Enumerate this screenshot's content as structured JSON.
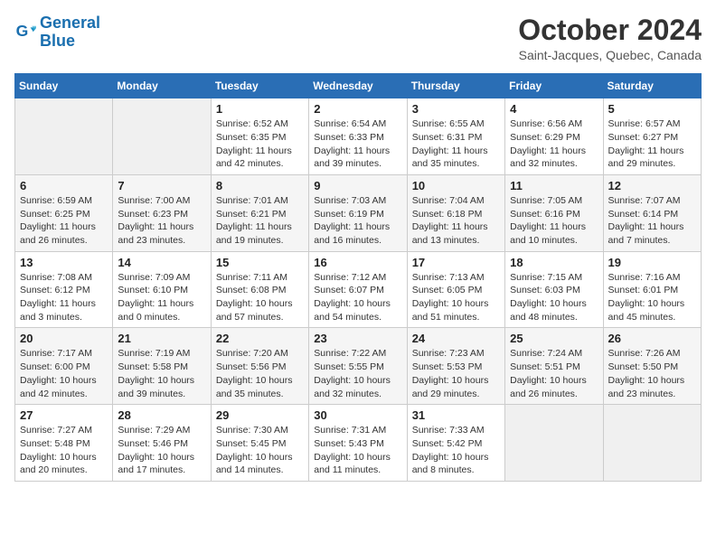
{
  "header": {
    "logo_line1": "General",
    "logo_line2": "Blue",
    "month": "October 2024",
    "location": "Saint-Jacques, Quebec, Canada"
  },
  "weekdays": [
    "Sunday",
    "Monday",
    "Tuesday",
    "Wednesday",
    "Thursday",
    "Friday",
    "Saturday"
  ],
  "weeks": [
    [
      {
        "day": "",
        "info": ""
      },
      {
        "day": "",
        "info": ""
      },
      {
        "day": "1",
        "info": "Sunrise: 6:52 AM\nSunset: 6:35 PM\nDaylight: 11 hours and 42 minutes."
      },
      {
        "day": "2",
        "info": "Sunrise: 6:54 AM\nSunset: 6:33 PM\nDaylight: 11 hours and 39 minutes."
      },
      {
        "day": "3",
        "info": "Sunrise: 6:55 AM\nSunset: 6:31 PM\nDaylight: 11 hours and 35 minutes."
      },
      {
        "day": "4",
        "info": "Sunrise: 6:56 AM\nSunset: 6:29 PM\nDaylight: 11 hours and 32 minutes."
      },
      {
        "day": "5",
        "info": "Sunrise: 6:57 AM\nSunset: 6:27 PM\nDaylight: 11 hours and 29 minutes."
      }
    ],
    [
      {
        "day": "6",
        "info": "Sunrise: 6:59 AM\nSunset: 6:25 PM\nDaylight: 11 hours and 26 minutes."
      },
      {
        "day": "7",
        "info": "Sunrise: 7:00 AM\nSunset: 6:23 PM\nDaylight: 11 hours and 23 minutes."
      },
      {
        "day": "8",
        "info": "Sunrise: 7:01 AM\nSunset: 6:21 PM\nDaylight: 11 hours and 19 minutes."
      },
      {
        "day": "9",
        "info": "Sunrise: 7:03 AM\nSunset: 6:19 PM\nDaylight: 11 hours and 16 minutes."
      },
      {
        "day": "10",
        "info": "Sunrise: 7:04 AM\nSunset: 6:18 PM\nDaylight: 11 hours and 13 minutes."
      },
      {
        "day": "11",
        "info": "Sunrise: 7:05 AM\nSunset: 6:16 PM\nDaylight: 11 hours and 10 minutes."
      },
      {
        "day": "12",
        "info": "Sunrise: 7:07 AM\nSunset: 6:14 PM\nDaylight: 11 hours and 7 minutes."
      }
    ],
    [
      {
        "day": "13",
        "info": "Sunrise: 7:08 AM\nSunset: 6:12 PM\nDaylight: 11 hours and 3 minutes."
      },
      {
        "day": "14",
        "info": "Sunrise: 7:09 AM\nSunset: 6:10 PM\nDaylight: 11 hours and 0 minutes."
      },
      {
        "day": "15",
        "info": "Sunrise: 7:11 AM\nSunset: 6:08 PM\nDaylight: 10 hours and 57 minutes."
      },
      {
        "day": "16",
        "info": "Sunrise: 7:12 AM\nSunset: 6:07 PM\nDaylight: 10 hours and 54 minutes."
      },
      {
        "day": "17",
        "info": "Sunrise: 7:13 AM\nSunset: 6:05 PM\nDaylight: 10 hours and 51 minutes."
      },
      {
        "day": "18",
        "info": "Sunrise: 7:15 AM\nSunset: 6:03 PM\nDaylight: 10 hours and 48 minutes."
      },
      {
        "day": "19",
        "info": "Sunrise: 7:16 AM\nSunset: 6:01 PM\nDaylight: 10 hours and 45 minutes."
      }
    ],
    [
      {
        "day": "20",
        "info": "Sunrise: 7:17 AM\nSunset: 6:00 PM\nDaylight: 10 hours and 42 minutes."
      },
      {
        "day": "21",
        "info": "Sunrise: 7:19 AM\nSunset: 5:58 PM\nDaylight: 10 hours and 39 minutes."
      },
      {
        "day": "22",
        "info": "Sunrise: 7:20 AM\nSunset: 5:56 PM\nDaylight: 10 hours and 35 minutes."
      },
      {
        "day": "23",
        "info": "Sunrise: 7:22 AM\nSunset: 5:55 PM\nDaylight: 10 hours and 32 minutes."
      },
      {
        "day": "24",
        "info": "Sunrise: 7:23 AM\nSunset: 5:53 PM\nDaylight: 10 hours and 29 minutes."
      },
      {
        "day": "25",
        "info": "Sunrise: 7:24 AM\nSunset: 5:51 PM\nDaylight: 10 hours and 26 minutes."
      },
      {
        "day": "26",
        "info": "Sunrise: 7:26 AM\nSunset: 5:50 PM\nDaylight: 10 hours and 23 minutes."
      }
    ],
    [
      {
        "day": "27",
        "info": "Sunrise: 7:27 AM\nSunset: 5:48 PM\nDaylight: 10 hours and 20 minutes."
      },
      {
        "day": "28",
        "info": "Sunrise: 7:29 AM\nSunset: 5:46 PM\nDaylight: 10 hours and 17 minutes."
      },
      {
        "day": "29",
        "info": "Sunrise: 7:30 AM\nSunset: 5:45 PM\nDaylight: 10 hours and 14 minutes."
      },
      {
        "day": "30",
        "info": "Sunrise: 7:31 AM\nSunset: 5:43 PM\nDaylight: 10 hours and 11 minutes."
      },
      {
        "day": "31",
        "info": "Sunrise: 7:33 AM\nSunset: 5:42 PM\nDaylight: 10 hours and 8 minutes."
      },
      {
        "day": "",
        "info": ""
      },
      {
        "day": "",
        "info": ""
      }
    ]
  ]
}
